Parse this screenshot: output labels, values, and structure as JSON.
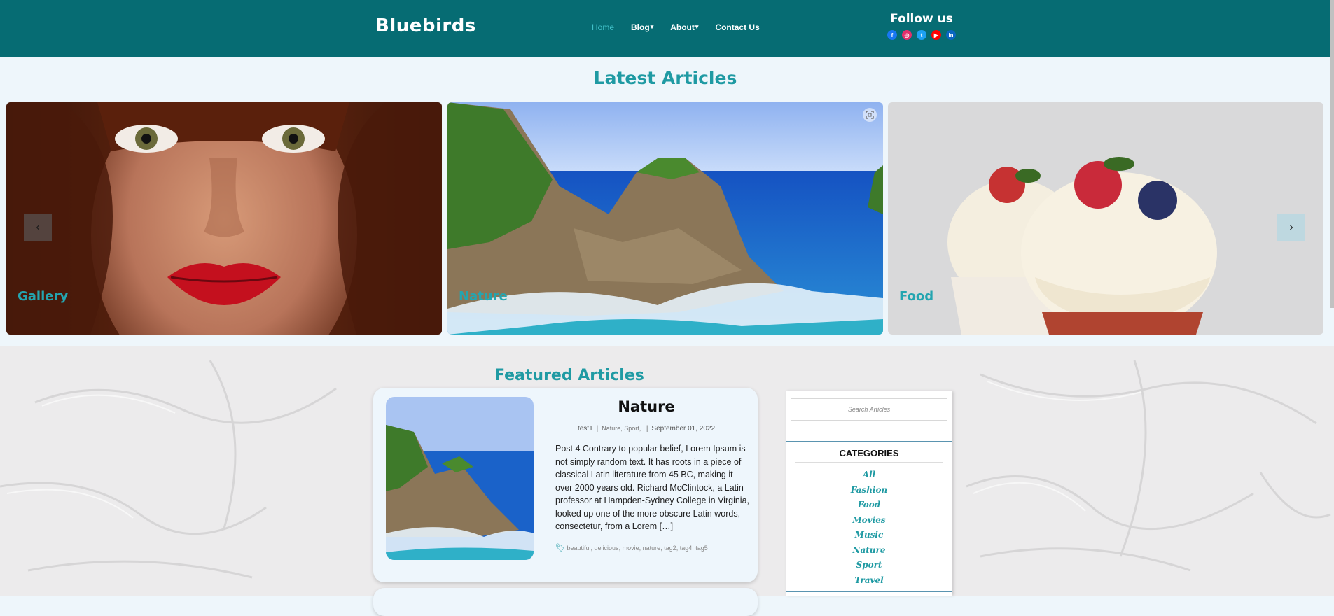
{
  "header": {
    "brand": "Bluebirds",
    "nav": [
      {
        "label": "Home",
        "active": true,
        "caret": ""
      },
      {
        "label": "Blog",
        "active": false,
        "caret": "▾"
      },
      {
        "label": "About",
        "active": false,
        "caret": "▾"
      },
      {
        "label": "Contact Us",
        "active": false,
        "caret": ""
      }
    ],
    "follow_title": "Follow us",
    "socials": [
      {
        "name": "facebook-icon",
        "glyph": "f",
        "color": "#1877f2"
      },
      {
        "name": "instagram-icon",
        "glyph": "◎",
        "color": "#e1306c"
      },
      {
        "name": "twitter-icon",
        "glyph": "t",
        "color": "#1da1f2"
      },
      {
        "name": "youtube-icon",
        "glyph": "▶",
        "color": "#ff0000"
      },
      {
        "name": "linkedin-icon",
        "glyph": "in",
        "color": "#0a66c2"
      }
    ]
  },
  "latest": {
    "title": "Latest Articles",
    "slides": [
      {
        "label": "Gallery"
      },
      {
        "label": "Nature"
      },
      {
        "label": "Food"
      }
    ],
    "prev": "‹",
    "next": "›"
  },
  "featured": {
    "title": "Featured Articles",
    "post": {
      "title": "Nature",
      "author": "test1",
      "categories": [
        "Nature",
        "Sport"
      ],
      "date": "September 01, 2022",
      "excerpt": "Post 4 Contrary to popular belief, Lorem Ipsum is not simply random text. It has roots in a piece of classical Latin literature from 45 BC, making it over 2000 years old. Richard McClintock, a Latin professor at Hampden-Sydney College in Virginia, looked up one of the more obscure Latin words, consectetur, from a Lorem […]",
      "tags": [
        "beautiful",
        "delicious",
        "movie",
        "nature",
        "tag2",
        "tag4",
        "tag5"
      ]
    }
  },
  "sidebar": {
    "search_placeholder": "Search Articles",
    "categories_heading": "CATEGORIES",
    "categories": [
      "All",
      "Fashion",
      "Food",
      "Movies",
      "Music",
      "Nature",
      "Sport",
      "Travel"
    ]
  },
  "colors": {
    "header_bg": "#066c73",
    "accent": "#1f9aa3",
    "page_bg": "#eef6fb"
  }
}
